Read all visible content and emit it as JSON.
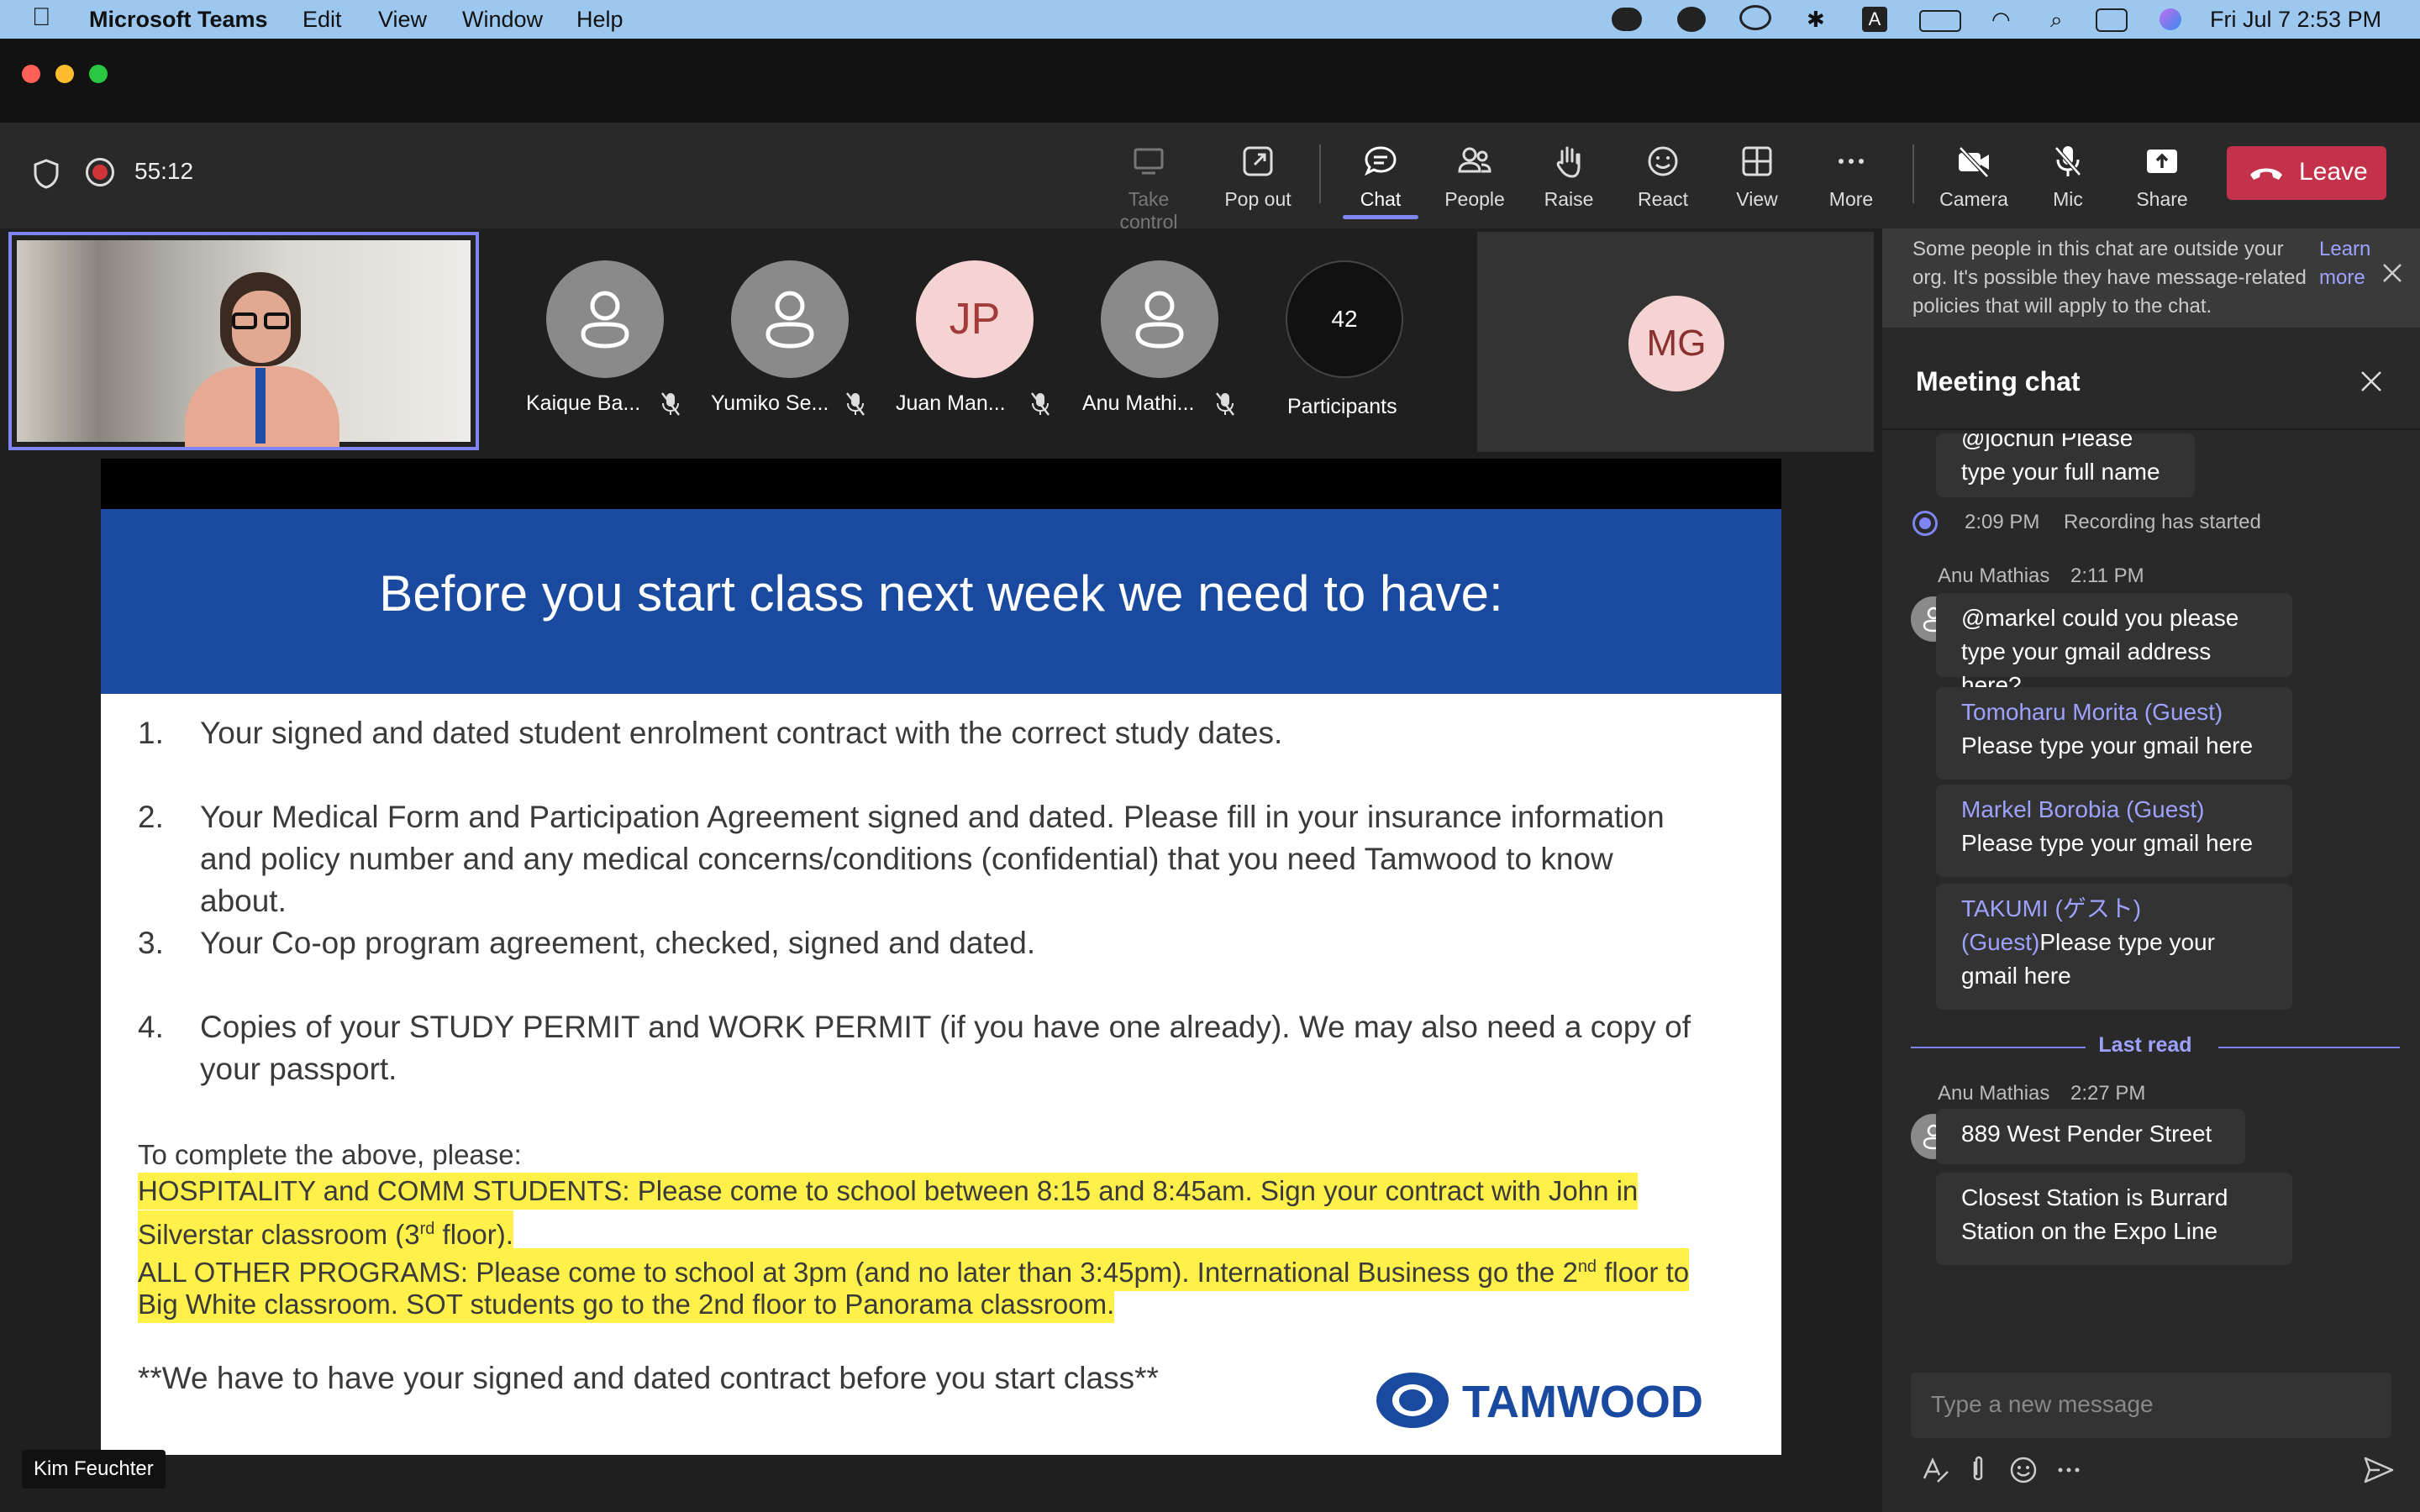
{
  "menubar": {
    "app": "Microsoft Teams",
    "items": [
      "Edit",
      "View",
      "Window",
      "Help"
    ],
    "clock": "Fri Jul 7  2:53 PM",
    "tray_icons": [
      "line-icon",
      "wechat-icon",
      "creative-cloud-icon",
      "bluetooth-icon",
      "keyboard-input-icon",
      "battery-icon",
      "wifi-icon",
      "search-icon",
      "control-center-icon",
      "siri-icon"
    ]
  },
  "toolbar": {
    "timer": "55:12",
    "take_control": "Take control",
    "pop_out": "Pop out",
    "chat": "Chat",
    "people": "People",
    "raise": "Raise",
    "react": "React",
    "view": "View",
    "more": "More",
    "camera": "Camera",
    "mic": "Mic",
    "share": "Share",
    "leave": "Leave"
  },
  "participants": [
    {
      "name": "Kaique Ba...",
      "initials": ""
    },
    {
      "name": "Yumiko Se...",
      "initials": ""
    },
    {
      "name": "Juan Man...",
      "initials": "JP"
    },
    {
      "name": "Anu Mathi...",
      "initials": ""
    }
  ],
  "participants_count": "42",
  "participants_label": "Participants",
  "mg_initials": "MG",
  "presenter_name": "Kim Feuchter",
  "slide": {
    "title": "Before you start class next week we need to have:",
    "items": [
      {
        "num": "1.",
        "lines": [
          "Your signed and dated student enrolment contract with the correct study dates."
        ]
      },
      {
        "num": "2.",
        "lines": [
          "Your Medical Form and Participation Agreement signed and dated.  Please fill in your insurance information",
          "and policy number and any medical concerns/conditions (confidential) that you need Tamwood to know",
          "about."
        ]
      },
      {
        "num": "3.",
        "lines": [
          "Your Co-op program agreement, checked, signed and dated."
        ]
      },
      {
        "num": "4.",
        "lines": [
          "Copies of your STUDY PERMIT and WORK PERMIT (if you have one already).  We may also need a copy of",
          "your passport."
        ]
      }
    ],
    "complete_intro": "To complete the above, please:",
    "hosp_1": "HOSPITALITY and COMM STUDENTS: Please come to school between 8:15 and 8:45am.  Sign your contract with John in",
    "hosp_2a": "Silverstar classroom (3",
    "hosp_2sup": "rd",
    "hosp_2b": " floor).",
    "other_1a": "ALL OTHER PROGRAMS: Please come to school at 3pm (and no later than 3:45pm).  International Business go the 2",
    "other_1sup": "nd",
    "other_1b": " floor to",
    "other_2": "Big White classroom.  SOT students go to the 2nd floor to Panorama classroom.",
    "footer": "**We have to have your signed and dated contract before you start class**",
    "logo": "TAMWOOD"
  },
  "chat": {
    "notice": "Some people in this chat are outside your org. It's possible they have message-related policies that will apply to the chat.",
    "notice_link": "Learn more",
    "title": "Meeting chat",
    "partial_msg": "@jochun Please type your full name",
    "rec_time": "2:09 PM",
    "rec_text": "Recording has started",
    "msg1_author": "Anu Mathias",
    "msg1_time": "2:11 PM",
    "msg1_text": "@markel could you please type your gmail address here?",
    "mention2": "Tomoharu Morita (Guest)",
    "msg2_text": " Please type your gmail here",
    "mention3": "Markel Borobia (Guest)",
    "msg3_text": " Please type your gmail here",
    "mention4": "TAKUMI (ゲスト) (Guest)",
    "msg4_text": "Please type your gmail here",
    "last_read": "Last read",
    "msg5_author": "Anu Mathias",
    "msg5_time": "2:27 PM",
    "msg5_text": "889 West Pender Street",
    "msg6_text": "Closest Station is Burrard Station on the Expo Line",
    "input_placeholder": "Type a new message"
  },
  "colors": {
    "leave": "#c4314b",
    "accent": "#7f85f5",
    "slide_blue": "#1a4aa0",
    "highlight": "#fff04a"
  }
}
